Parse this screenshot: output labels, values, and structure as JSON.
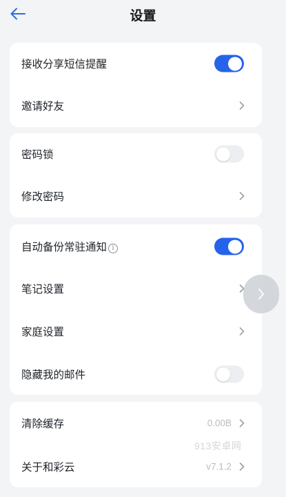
{
  "header": {
    "title": "设置"
  },
  "groups": [
    {
      "items": [
        {
          "label": "接收分享短信提醒",
          "type": "toggle",
          "state": "on"
        },
        {
          "label": "邀请好友",
          "type": "link"
        }
      ]
    },
    {
      "items": [
        {
          "label": "密码锁",
          "type": "toggle",
          "state": "off"
        },
        {
          "label": "修改密码",
          "type": "link"
        }
      ]
    },
    {
      "items": [
        {
          "label": "自动备份常驻通知",
          "type": "toggle",
          "state": "on",
          "info_icon": "info-icon"
        },
        {
          "label": "笔记设置",
          "type": "link"
        },
        {
          "label": "家庭设置",
          "type": "link"
        },
        {
          "label": "隐藏我的邮件",
          "type": "toggle",
          "state": "off"
        }
      ]
    },
    {
      "items": [
        {
          "label": "清除缓存",
          "type": "link",
          "value": "0.00B"
        },
        {
          "label": "关于和彩云",
          "type": "link",
          "value": "v7.1.2"
        }
      ]
    }
  ],
  "watermark": "913安卓网",
  "colors": {
    "accent": "#2563eb",
    "background": "#f3f4f6",
    "card": "#ffffff"
  },
  "icons": {
    "back": "arrow-left-icon",
    "chevron": "chevron-right-icon",
    "info": "info-icon"
  }
}
